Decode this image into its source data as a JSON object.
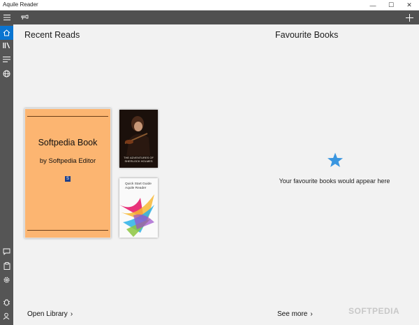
{
  "app": {
    "title": "Aquile Reader"
  },
  "window_controls": {
    "minimize": "—",
    "maximize": "☐",
    "close": "✕"
  },
  "toolbar": {
    "menu_icon": "hamburger-menu-icon",
    "pin_icon": "pin-icon",
    "add_icon": "plus-icon"
  },
  "rail": {
    "top_items": [
      {
        "name": "home",
        "icon": "home-icon",
        "active": true
      },
      {
        "name": "library",
        "icon": "library-icon",
        "active": false
      },
      {
        "name": "list",
        "icon": "list-icon",
        "active": false
      },
      {
        "name": "web",
        "icon": "globe-icon",
        "active": false
      }
    ],
    "bottom_items": [
      {
        "name": "feedback",
        "icon": "feedback-icon"
      },
      {
        "name": "clipboard",
        "icon": "clipboard-icon"
      },
      {
        "name": "settings",
        "icon": "gear-icon"
      },
      {
        "name": "debug",
        "icon": "bug-icon"
      },
      {
        "name": "account",
        "icon": "person-icon"
      }
    ]
  },
  "recent": {
    "title": "Recent Reads",
    "main_book": {
      "title": "Softpedia Book",
      "author": "by Softpedia Editor",
      "logo_text": "S"
    },
    "sherlock_book": {
      "title": "THE ADVENTURES OF SHERLOCK HOLMES"
    },
    "quick_book": {
      "title": "Quick Start Guide",
      "subtitle": "Aquile Reader"
    },
    "footer_link": "Open Library"
  },
  "favourites": {
    "title": "Favourite Books",
    "empty_text": "Your favourite books would appear here",
    "footer_link": "See more"
  },
  "watermark": "SOFTPEDIA",
  "colors": {
    "accent": "#0a74d0",
    "toolbar": "#505050",
    "rail": "#555555",
    "book_cover": "#fcb571",
    "star": "#3a96e0"
  }
}
